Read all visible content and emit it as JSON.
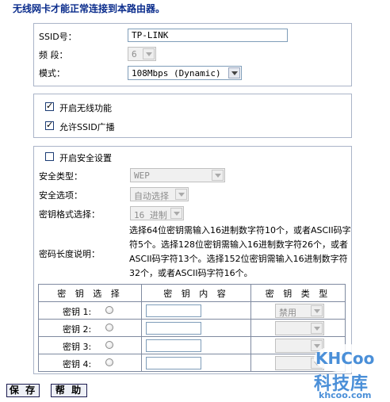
{
  "notice": "无线网卡才能正常连接到本路由器。",
  "basic": {
    "ssid_label": "SSID号：",
    "ssid_value": "TP-LINK",
    "channel_label": "频 段：",
    "channel_value": "6",
    "mode_label": "模式：",
    "mode_value": "108Mbps (Dynamic)"
  },
  "wireless": {
    "enable_label": "开启无线功能",
    "enable_checked": true,
    "broadcast_label": "允许SSID广播",
    "broadcast_checked": true
  },
  "security": {
    "enable_label": "开启安全设置",
    "enable_checked": false,
    "type_label": "安全类型：",
    "type_value": "WEP",
    "option_label": "安全选项：",
    "option_value": "自动选择",
    "format_label": "密钥格式选择：",
    "format_value": "16 进制",
    "desc_label": "密码长度说明：",
    "desc_text": "选择64位密钥需输入16进制数字符10个，或者ASCII码字符5个。选择128位密钥需输入16进制数字符26个，或者ASCII码字符13个。选择152位密钥需输入16进制数字符32个，或者ASCII码字符16个。"
  },
  "keys_table": {
    "headers": [
      "密 钥 选 择",
      "密 钥 内 容",
      "密 钥 类 型"
    ],
    "rows": [
      {
        "label": "密钥 1:",
        "type": "禁用"
      },
      {
        "label": "密钥 2:",
        "type": ""
      },
      {
        "label": "密钥 3:",
        "type": ""
      },
      {
        "label": "密钥 4:",
        "type": ""
      }
    ]
  },
  "buttons": {
    "save": "保 存",
    "help": "帮 助"
  },
  "watermark": {
    "logo": "KHCoo",
    "name": "科技库",
    "url": "khcoo.com"
  },
  "colors": {
    "notice": "#0a2c8c",
    "border": "#aab4c8",
    "watermark": "#4a8fd8"
  }
}
